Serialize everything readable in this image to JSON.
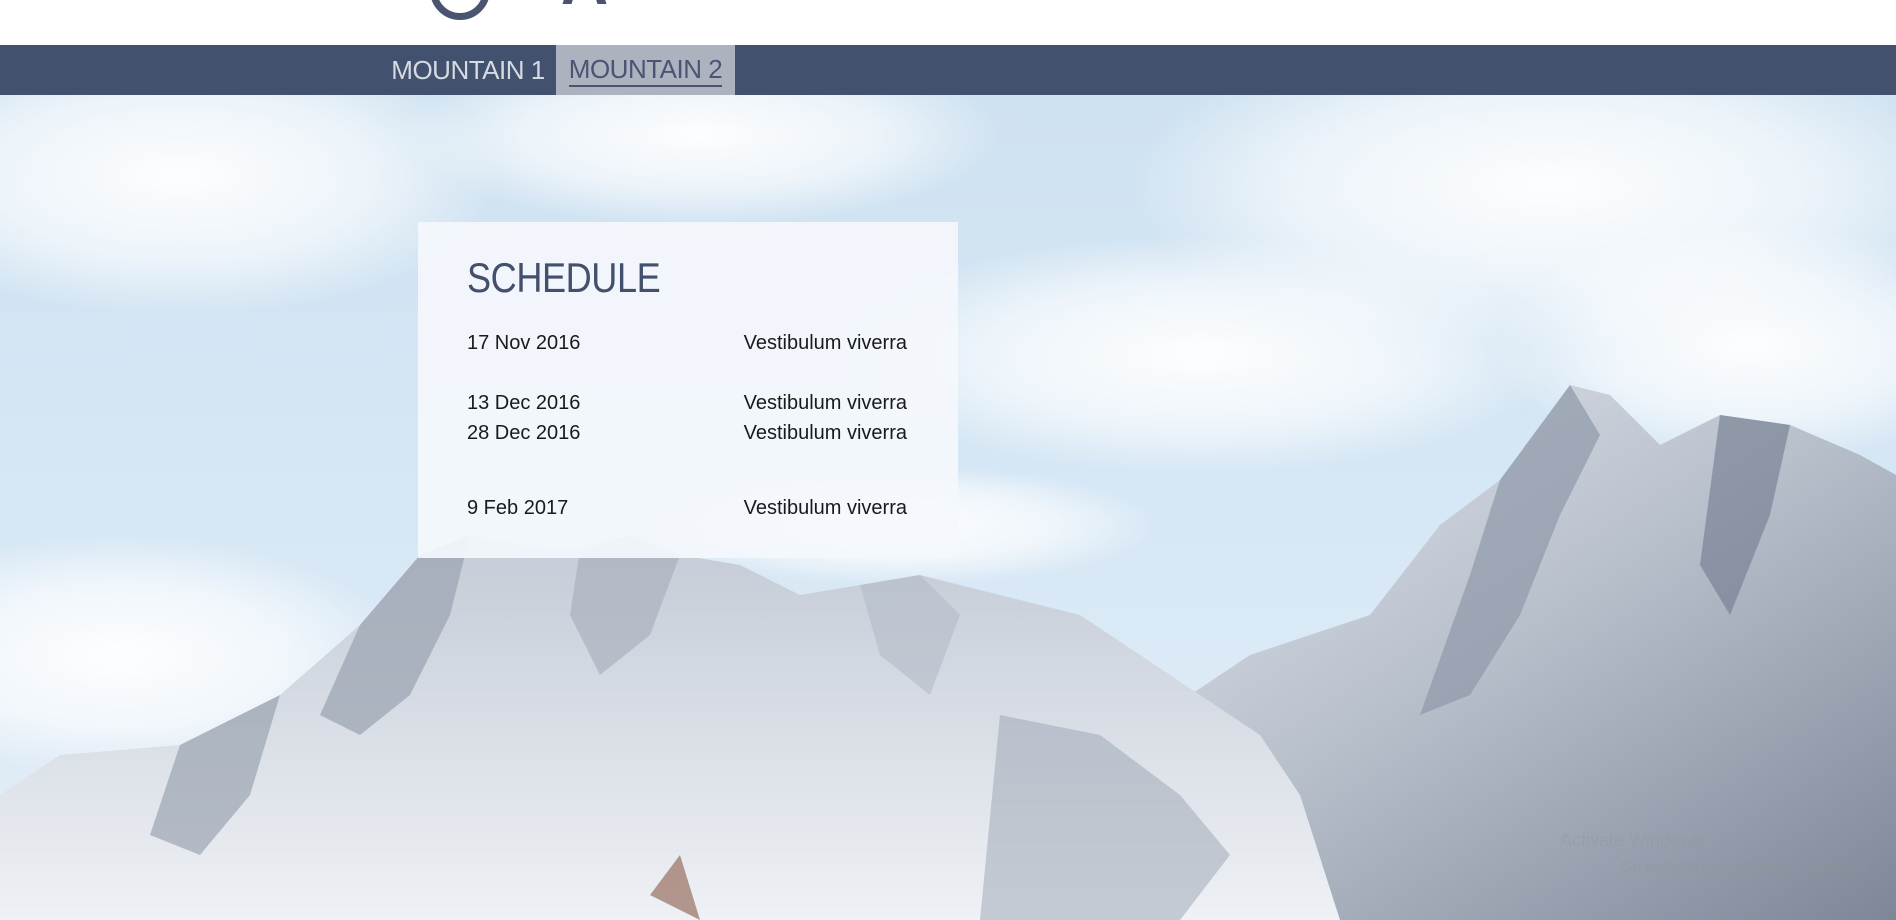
{
  "navigation": {
    "tabs": [
      {
        "label": "MOUNTAIN 1",
        "active": false
      },
      {
        "label": "MOUNTAIN 2",
        "active": true
      }
    ]
  },
  "schedule": {
    "title": "SCHEDULE",
    "rows": [
      {
        "date": "17 Nov 2016",
        "event": "Vestibulum viverra"
      },
      {
        "date": "13 Dec 2016",
        "event": "Vestibulum viverra"
      },
      {
        "date": "28 Dec 2016",
        "event": "Vestibulum viverra"
      },
      {
        "date": "9 Feb 2017",
        "event": "Vestibulum viverra"
      }
    ]
  },
  "watermark": {
    "line1": "Activate Windows",
    "line2": "Go to Settings to activate Windows."
  },
  "colors": {
    "nav_background": "#42516e",
    "active_tab_background": "#adb2bf",
    "title_color": "#43506c"
  }
}
